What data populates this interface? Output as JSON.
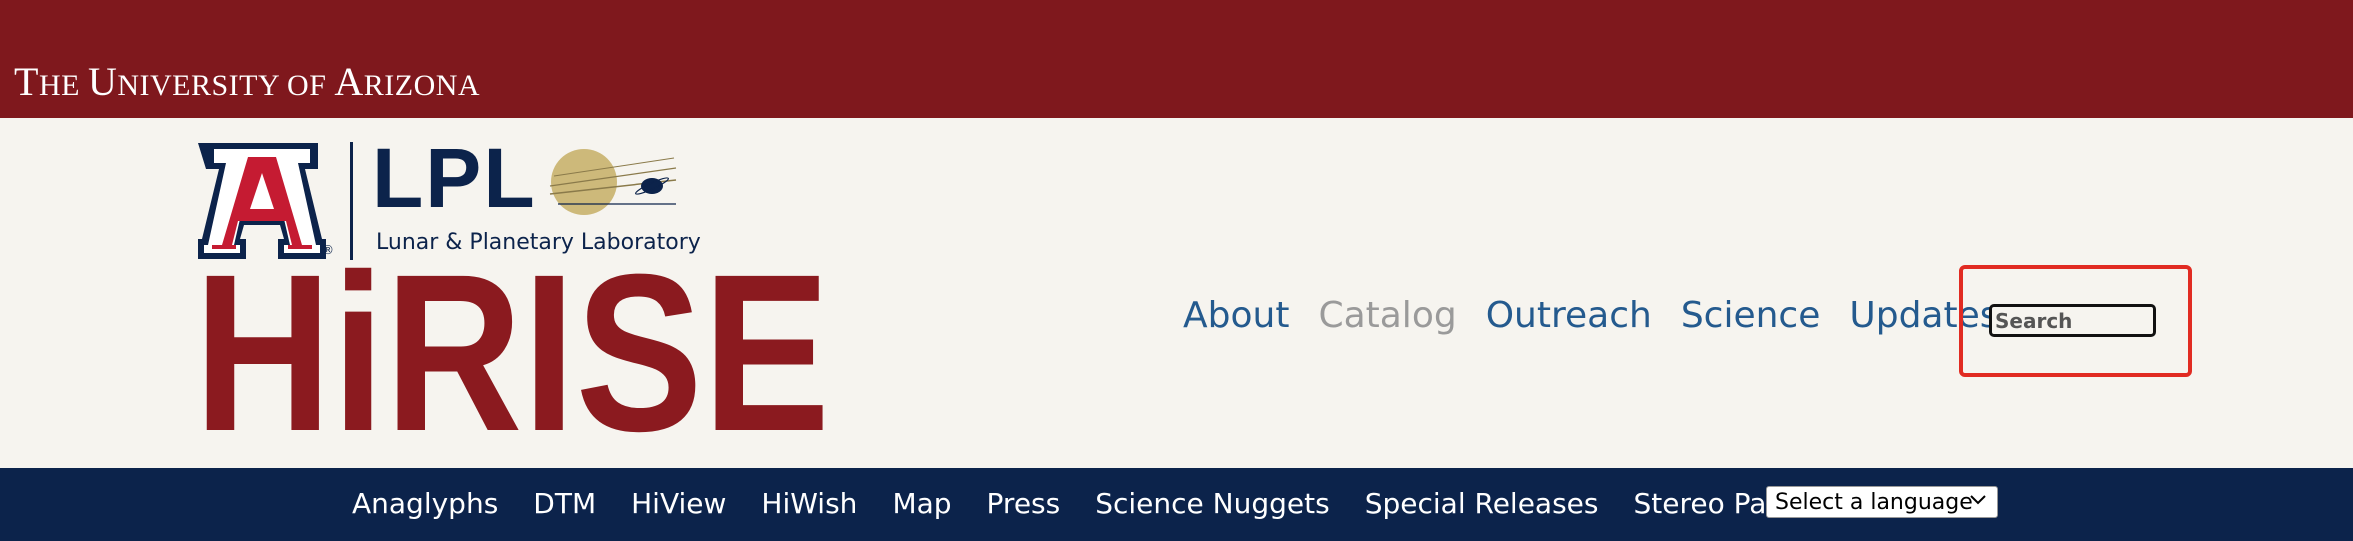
{
  "university": {
    "title_parts": [
      "T",
      "HE ",
      "U",
      "NIVERSITY OF ",
      "A",
      "RIZONA"
    ]
  },
  "lpl": {
    "acronym": "LPL",
    "subtitle": "Lunar & Planetary Laboratory",
    "registered_mark": "®"
  },
  "brand": {
    "name": "HiRISE",
    "color": "#8b1a1f"
  },
  "main_nav": [
    {
      "label": "About",
      "active": false
    },
    {
      "label": "Catalog",
      "active": true
    },
    {
      "label": "Outreach",
      "active": false
    },
    {
      "label": "Science",
      "active": false
    },
    {
      "label": "Updates",
      "active": false
    }
  ],
  "search": {
    "placeholder": "Search",
    "value": ""
  },
  "sub_nav": [
    "Anaglyphs",
    "DTM",
    "HiView",
    "HiWish",
    "Map",
    "Press",
    "Science Nuggets",
    "Special Releases",
    "Stereo Pairs"
  ],
  "language_select": {
    "selected": "Select a language"
  },
  "colors": {
    "ua_red": "#7f181d",
    "navy": "#0c234b",
    "link_blue": "#245a8e",
    "highlight": "#e12b22"
  }
}
